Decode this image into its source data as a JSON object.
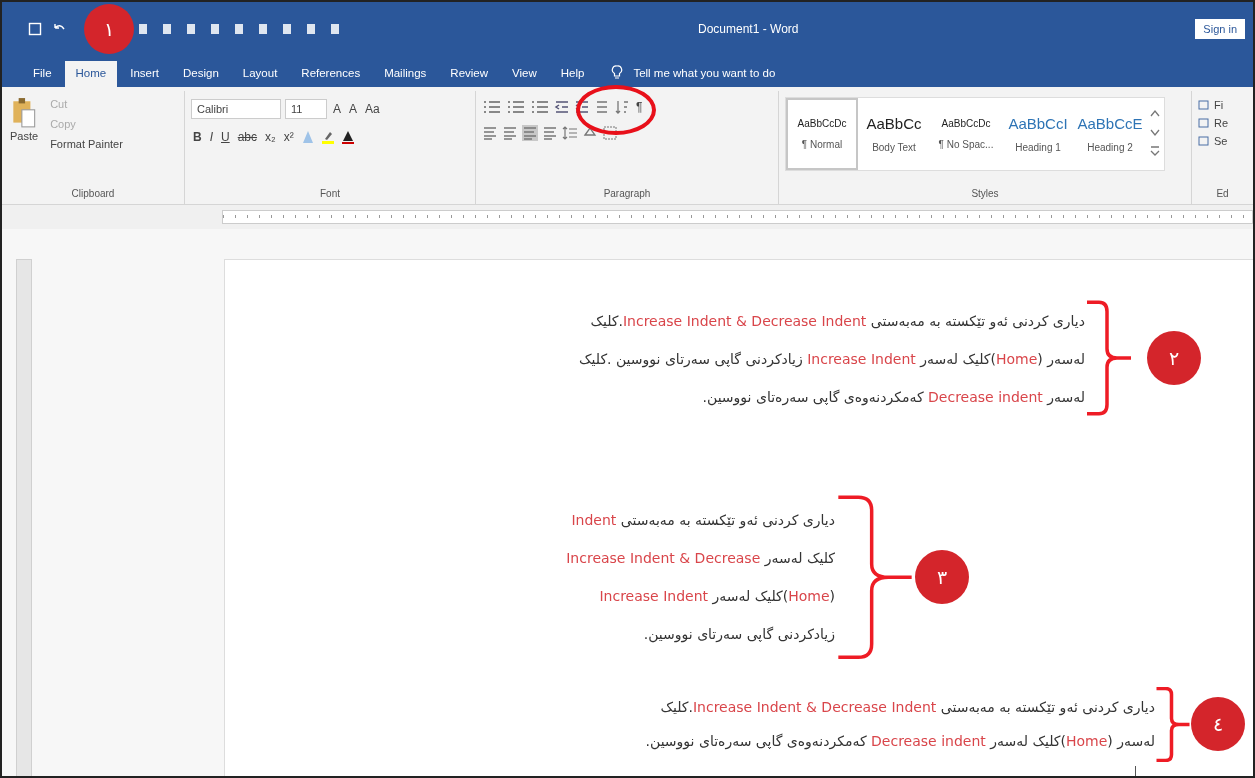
{
  "window": {
    "title": "Document1 - Word",
    "sign_in": "Sign in"
  },
  "tabs": [
    {
      "label": "File",
      "selected": false
    },
    {
      "label": "Home",
      "selected": true
    },
    {
      "label": "Insert",
      "selected": false
    },
    {
      "label": "Design",
      "selected": false
    },
    {
      "label": "Layout",
      "selected": false
    },
    {
      "label": "References",
      "selected": false
    },
    {
      "label": "Mailings",
      "selected": false
    },
    {
      "label": "Review",
      "selected": false
    },
    {
      "label": "View",
      "selected": false
    },
    {
      "label": "Help",
      "selected": false
    }
  ],
  "tell_me": "Tell me what you want to do",
  "ribbon": {
    "clipboard": {
      "label": "Clipboard",
      "paste": "Paste",
      "cut": "Cut",
      "copy": "Copy",
      "format_painter": "Format Painter"
    },
    "font": {
      "label": "Font",
      "name": "Calibri",
      "size": "11",
      "size_buttons": [
        "A",
        "A",
        "Aa"
      ],
      "format_buttons": [
        "B",
        "I",
        "U",
        "abc",
        "x₂",
        "x²"
      ]
    },
    "paragraph": {
      "label": "Paragraph",
      "show_marks": "¶"
    },
    "styles": {
      "label": "Styles",
      "items": [
        {
          "sample": "AaBbCcDc",
          "name": "¶ Normal",
          "kind": "small",
          "selected": true
        },
        {
          "sample": "AaBbCc",
          "name": "Body Text",
          "kind": "large",
          "selected": false
        },
        {
          "sample": "AaBbCcDc",
          "name": "¶ No Spac...",
          "kind": "small",
          "selected": false
        },
        {
          "sample": "AaBbCcI",
          "name": "Heading 1",
          "kind": "heading",
          "selected": false
        },
        {
          "sample": "AaBbCcE",
          "name": "Heading 2",
          "kind": "heading",
          "selected": false
        }
      ]
    },
    "editing": {
      "label": "Ed",
      "items": [
        "Fi",
        "Re",
        "Se"
      ]
    }
  },
  "step_badge": "١",
  "blocks": [
    {
      "badge": "٢",
      "lines": [
        "دیاری کردنی ئەو تێکستە بە مەبەستی **Increase Indent & Decrease Indent**.کلیک",
        "لەسەر (**Home**)کلیک لەسەر **Increase Indent** زیادکردنی گاپی سەرتای نووسین .کلیک",
        "لەسەر **Decrease indent** کەمکردنەوەی گاپی سەرەتای نووسین."
      ]
    },
    {
      "badge": "٣",
      "lines": [
        "دیاری کردنی ئەو تێکستە بە مەبەستی **Indent**",
        "کلیک لەسەر **Increase Indent & Decrease**",
        "(**Home**)کلیک لەسەر **Increase Indent**",
        "زیادکردنی گاپی سەرتای نووسین."
      ]
    },
    {
      "badge": "٤",
      "lines": [
        "دیاری کردنی ئەو تێکستە بە مەبەستی **Increase Indent & Decrease Indent**.کلیک",
        "لەسەر (**Home**)کلیک لەسەر **Decrease indent** کەمکردنەوەی گاپی سەرەتای نووسین."
      ]
    }
  ]
}
